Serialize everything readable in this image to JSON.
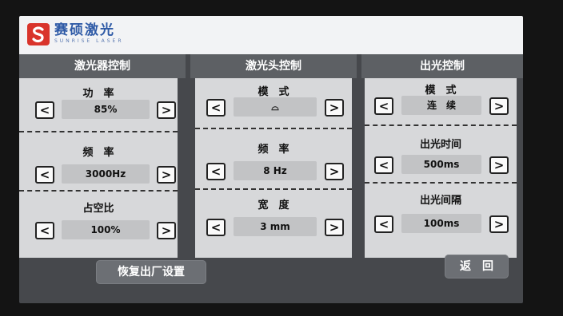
{
  "brand": {
    "name_cn": "赛硕激光",
    "name_en": "SUNRISE LASER"
  },
  "columns": [
    {
      "title": "激光器控制",
      "sections": [
        {
          "label": "功　率",
          "value": "85%"
        },
        {
          "label": "频　率",
          "value": "3000Hz"
        },
        {
          "label": "占空比",
          "value": "100%"
        }
      ]
    },
    {
      "title": "激光头控制",
      "sections": [
        {
          "label": "模　式",
          "value": "⌓"
        },
        {
          "label": "频　率",
          "value": "8 Hz"
        },
        {
          "label": "宽　度",
          "value": "3 mm"
        }
      ]
    },
    {
      "title": "出光控制",
      "sections": [
        {
          "label": "模　式",
          "value": "连　续"
        },
        {
          "label": "出光时间",
          "value": "500ms"
        },
        {
          "label": "出光间隔",
          "value": "100ms"
        }
      ]
    }
  ],
  "arrows": {
    "prev": "<",
    "next": ">"
  },
  "buttons": {
    "factory_reset": "恢复出厂设置",
    "back": "返　回"
  },
  "colors": {
    "brand_blue": "#2e5aa6",
    "logo_red": "#d9342b",
    "header_bg": "#5d6064"
  }
}
